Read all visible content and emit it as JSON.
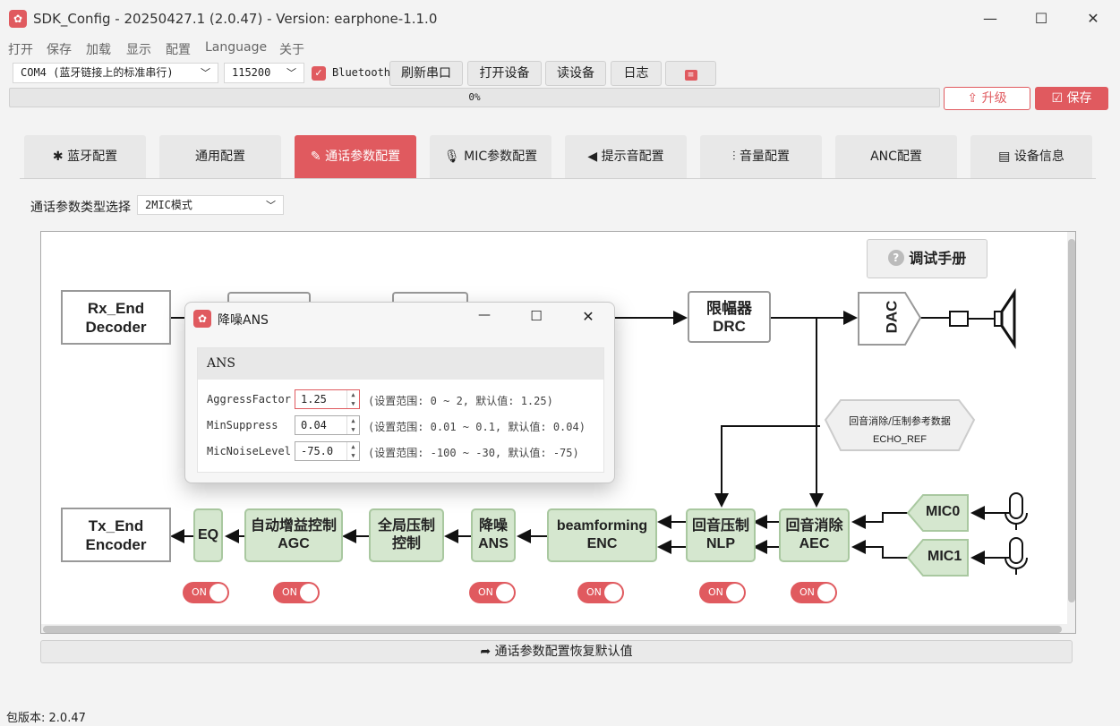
{
  "window": {
    "icon": "app-icon",
    "title": "SDK_Config -  20250427.1  (2.0.47) - Version: earphone-1.1.0",
    "minimize": "—",
    "maximize": "☐",
    "close": "✕"
  },
  "menu": [
    "打开",
    "保存",
    "加载",
    "显示",
    "配置",
    "Language",
    "关于"
  ],
  "toolbar": {
    "port": "COM4 (蓝牙链接上的标准串行)",
    "baud": "115200",
    "bluetooth_label": "Bluetooth",
    "bluetooth_checked": true,
    "refresh": "刷新串口",
    "open": "打开设备",
    "read": "读设备",
    "log": "日志",
    "settings_icon": "sliders-icon"
  },
  "progress": {
    "text": "0%",
    "value": 0
  },
  "actions": {
    "upgrade": "升级",
    "save": "保存"
  },
  "tabs": [
    {
      "label": "蓝牙配置",
      "icon": "bluetooth-icon"
    },
    {
      "label": "通用配置",
      "icon": ""
    },
    {
      "label": "通话参数配置",
      "icon": "edit-icon",
      "active": true
    },
    {
      "label": "MIC参数配置",
      "icon": "mic-icon"
    },
    {
      "label": "提示音配置",
      "icon": "speaker-icon"
    },
    {
      "label": "音量配置",
      "icon": "waveform-icon"
    },
    {
      "label": "ANC配置",
      "icon": ""
    },
    {
      "label": "设备信息",
      "icon": "clipboard-icon"
    }
  ],
  "type_select": {
    "label": "通话参数类型选择",
    "value": "2MIC模式"
  },
  "diagram": {
    "manual": "调试手册",
    "rx": [
      "Rx_End",
      "Decoder"
    ],
    "drc": [
      "限幅器",
      "DRC"
    ],
    "dac": "DAC",
    "echo_ref": [
      "回音消除/压制参考数据",
      "ECHO_REF"
    ],
    "tx": [
      "Tx_End",
      "Encoder"
    ],
    "eq": "EQ",
    "agc": [
      "自动增益控制",
      "AGC"
    ],
    "global": [
      "全局压制",
      "控制"
    ],
    "ans": [
      "降噪",
      "ANS"
    ],
    "enc": [
      "beamforming",
      "ENC"
    ],
    "nlp": [
      "回音压制",
      "NLP"
    ],
    "aec": [
      "回音消除",
      "AEC"
    ],
    "mic0": "MIC0",
    "mic1": "MIC1",
    "toggle_label": "ON"
  },
  "dialog": {
    "title": "降噪ANS",
    "section": "ANS",
    "params": [
      {
        "label": "AggressFactor",
        "value": "1.25",
        "hint": "(设置范围: 0 ~ 2, 默认值: 1.25)"
      },
      {
        "label": "MinSuppress",
        "value": "0.04",
        "hint": "(设置范围: 0.01 ~ 0.1, 默认值: 0.04)"
      },
      {
        "label": "MicNoiseLevel",
        "value": "-75.0",
        "hint": "(设置范围: -100 ~ -30, 默认值: -75)"
      }
    ]
  },
  "restore": "通话参数配置恢复默认值",
  "footer": {
    "version_label": "包版本:",
    "version": "2.0.47"
  }
}
